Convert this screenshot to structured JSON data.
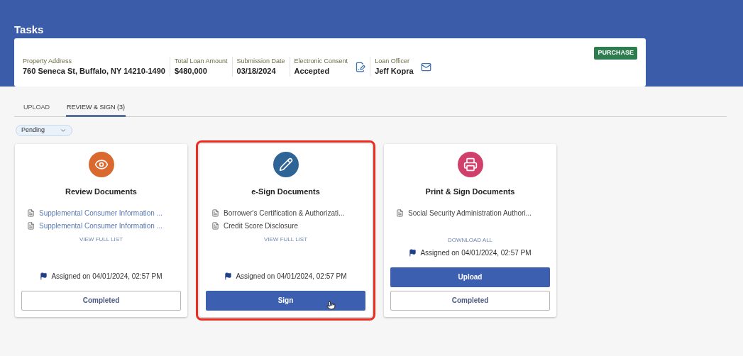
{
  "header": {
    "title": "Tasks"
  },
  "loan_summary": {
    "badge": "PURCHASE",
    "fields": [
      {
        "label": "Property Address",
        "value": "760 Seneca St, Buffalo, NY 14210-1490",
        "kind": "plain"
      },
      {
        "label": "Total Loan Amount",
        "value": "$480,000",
        "kind": "plain"
      },
      {
        "label": "Submission Date",
        "value": "03/18/2024",
        "kind": "plain"
      },
      {
        "label": "Electronic Consent",
        "value": "Accepted",
        "kind": "consent"
      },
      {
        "label": "Loan Officer",
        "value": "Jeff Kopra",
        "kind": "contact"
      }
    ]
  },
  "tabs": [
    {
      "label": "UPLOAD",
      "selected": false
    },
    {
      "label": "REVIEW & SIGN (3)",
      "selected": true
    }
  ],
  "filter": {
    "value": "Pending"
  },
  "cards": [
    {
      "kind": "review",
      "color": "#d9692f",
      "title": "Review Documents",
      "highlighted": false,
      "documents": [
        "Supplemental Consumer Information ...",
        "Supplemental Consumer Information ..."
      ],
      "link": "VIEW FULL LIST",
      "assigned": "Assigned on 04/01/2024, 02:57 PM",
      "buttons": [
        {
          "label": "Completed",
          "kind": "outline"
        }
      ]
    },
    {
      "kind": "esign",
      "color": "#2f6496",
      "title": "e-Sign Documents",
      "highlighted": true,
      "documents": [
        "Borrower's Certification & Authorizati...",
        "Credit Score Disclosure"
      ],
      "link": "VIEW FULL LIST",
      "assigned": "Assigned on 04/01/2024, 02:57 PM",
      "buttons": [
        {
          "label": "Sign",
          "kind": "primary"
        }
      ]
    },
    {
      "kind": "print",
      "color": "#d0406a",
      "title": "Print & Sign Documents",
      "highlighted": false,
      "documents": [
        "Social Security Administration Authori..."
      ],
      "link": "DOWNLOAD ALL",
      "assigned": "Assigned on 04/01/2024, 02:57 PM",
      "buttons": [
        {
          "label": "Upload",
          "kind": "primary"
        },
        {
          "label": "Completed",
          "kind": "outline"
        }
      ]
    }
  ]
}
